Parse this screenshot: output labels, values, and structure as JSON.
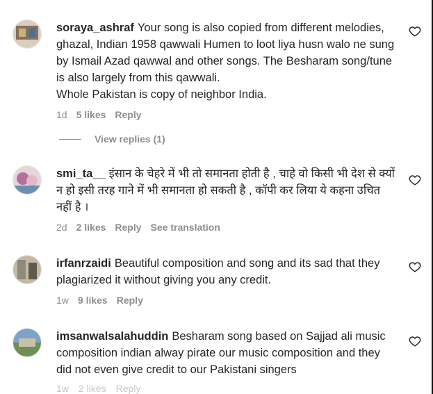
{
  "comments": [
    {
      "username": "soraya_ashraf",
      "text": "Your song is also copied from different melodies, ghazal, Indian 1958 qawwali Humen to loot liya husn walo ne sung by Ismail Azad qawwal and other songs. The Besharam song/tune is also largely from this qawwali.",
      "text2": "Whole Pakistan is copy of neighbor India.",
      "time": "1d",
      "likes": "5 likes",
      "reply": "Reply",
      "avatar_colors": [
        "#8a6f5a",
        "#c9b27a",
        "#4f6f8f"
      ]
    },
    {
      "username": "smi_ta__",
      "text": "इंसान के चेहरे में भी तो समानता होती है , चाहे वो किसी भी देश से क्यों न हो इसी तरह गाने में भी समानता हो सकती है , कॉपी कर लिया ये कहना उचित नहीं है ।",
      "time": "2d",
      "likes": "2 likes",
      "reply": "Reply",
      "translate": "See translation",
      "avatar_colors": [
        "#b46f9c",
        "#e0b8c8",
        "#6a8fb0"
      ]
    },
    {
      "username": "irfanrzaidi",
      "text": "Beautiful composition and song and its sad that they plagiarized it without giving you any credit.",
      "time": "1w",
      "likes": "9 likes",
      "reply": "Reply",
      "avatar_colors": [
        "#8d8a7e",
        "#c5b9a0",
        "#5e5a50"
      ]
    },
    {
      "username": "imsanwalsalahuddin",
      "text": "Besharam song based on Sajjad ali music composition indian alway pirate our music composition and they did not even give credit to our Pakistani singers",
      "time": "1w",
      "likes": "2 likes",
      "reply": "Reply",
      "avatar_colors": [
        "#7fa2c8",
        "#6f8f55",
        "#c9c2a8"
      ]
    }
  ],
  "view_replies": "View replies (1)"
}
